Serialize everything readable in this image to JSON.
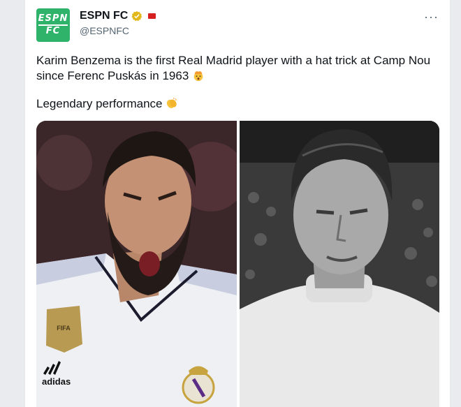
{
  "tweet": {
    "display_name": "ESPN FC",
    "handle": "@ESPNFC",
    "avatar_line1": "ESPN",
    "avatar_line2": "FC",
    "more_label": "···",
    "text_line1": "Karim Benzema is the first Real Madrid player with a hat trick at Camp Nou since Ferenc Puskás in 1963",
    "text_line2": "Legendary performance",
    "emoji1": "exploding-head",
    "emoji2": "clapping-hands"
  },
  "media": {
    "left_badge": "FIFA",
    "left_brand": "adidas",
    "right_description": ""
  },
  "colors": {
    "brand_green": "#2fb36b",
    "verified_gold": "#e2b719",
    "text": "#0f1419",
    "secondary": "#536471"
  }
}
